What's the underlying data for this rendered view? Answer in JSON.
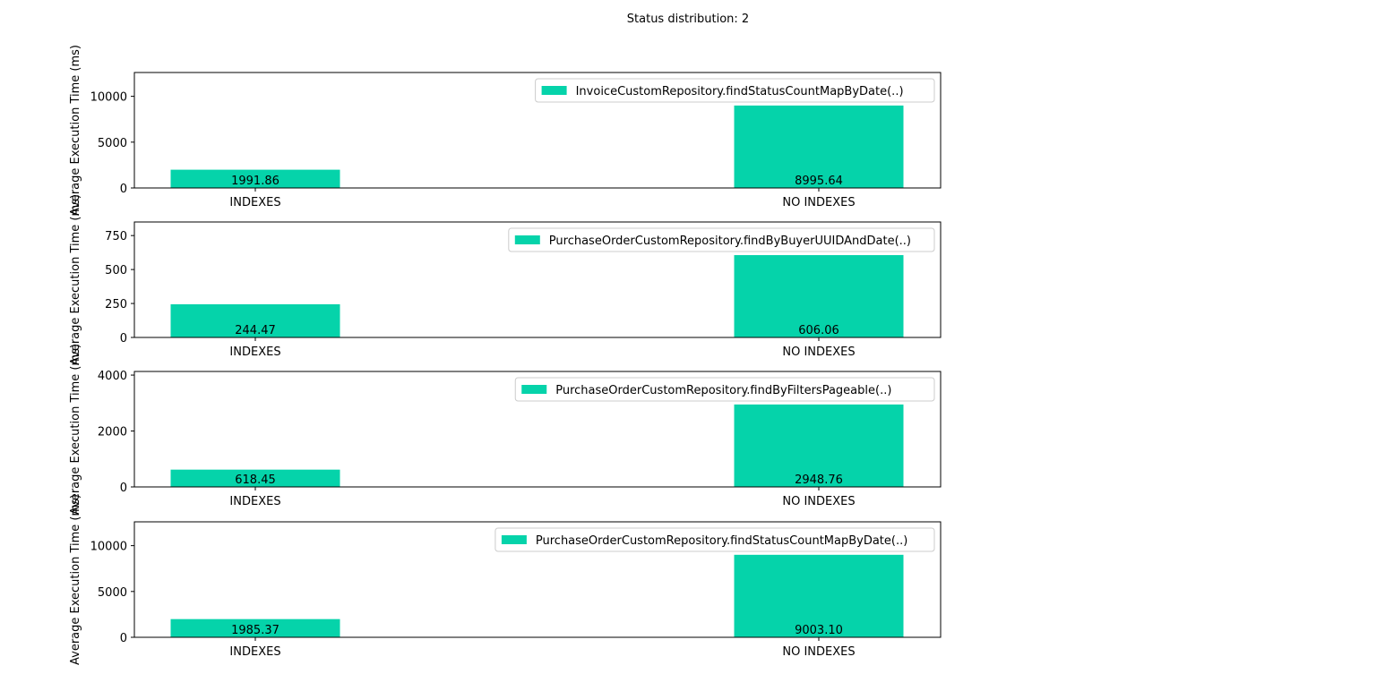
{
  "figure": {
    "suptitle": "Status distribution: 2"
  },
  "colors": {
    "bar": "#05d3aa",
    "axis": "#000000",
    "legend_border": "#cccccc"
  },
  "chart_data": [
    {
      "type": "bar",
      "categories": [
        "INDEXES",
        "NO INDEXES"
      ],
      "series": [
        {
          "name": "InvoiceCustomRepository.findStatusCountMapByDate(..)",
          "values": [
            1991.86,
            8995.64
          ]
        }
      ],
      "data_labels": [
        "1991.86",
        "8995.64"
      ],
      "ylabel": "Average Execution Time (ms)",
      "ylim": [
        0,
        12600
      ],
      "yticks": [
        0,
        5000,
        10000
      ],
      "legend": "top-right",
      "grid": false
    },
    {
      "type": "bar",
      "categories": [
        "INDEXES",
        "NO INDEXES"
      ],
      "series": [
        {
          "name": "PurchaseOrderCustomRepository.findByBuyerUUIDAndDate(..)",
          "values": [
            244.47,
            606.06
          ]
        }
      ],
      "data_labels": [
        "244.47",
        "606.06"
      ],
      "ylabel": "Average Execution Time (ms)",
      "ylim": [
        0,
        850
      ],
      "yticks": [
        0,
        250,
        500,
        750
      ],
      "legend": "top-right",
      "grid": false
    },
    {
      "type": "bar",
      "categories": [
        "INDEXES",
        "NO INDEXES"
      ],
      "series": [
        {
          "name": "PurchaseOrderCustomRepository.findByFiltersPageable(..)",
          "values": [
            618.45,
            2948.76
          ]
        }
      ],
      "data_labels": [
        "618.45",
        "2948.76"
      ],
      "ylabel": "Average Execution Time (ms)",
      "ylim": [
        0,
        4130
      ],
      "yticks": [
        0,
        2000,
        4000
      ],
      "legend": "top-right",
      "grid": false
    },
    {
      "type": "bar",
      "categories": [
        "INDEXES",
        "NO INDEXES"
      ],
      "series": [
        {
          "name": "PurchaseOrderCustomRepository.findStatusCountMapByDate(..)",
          "values": [
            1985.37,
            9003.1
          ]
        }
      ],
      "data_labels": [
        "1985.37",
        "9003.10"
      ],
      "ylabel": "Average Execution Time (ms)",
      "ylim": [
        0,
        12600
      ],
      "yticks": [
        0,
        5000,
        10000
      ],
      "legend": "top-right",
      "grid": false
    }
  ]
}
